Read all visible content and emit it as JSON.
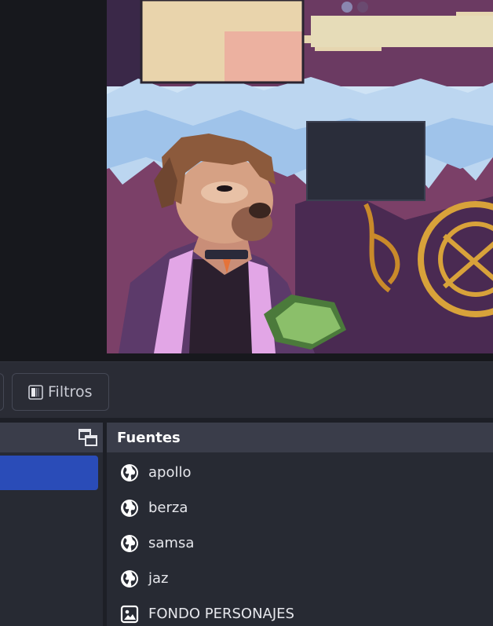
{
  "toolbar": {
    "filters_label": "Filtros"
  },
  "sources": {
    "title": "Fuentes",
    "items": [
      {
        "label": "apollo",
        "icon": "globe-icon"
      },
      {
        "label": "berza",
        "icon": "globe-icon"
      },
      {
        "label": "samsa",
        "icon": "globe-icon"
      },
      {
        "label": "jaz",
        "icon": "globe-icon"
      },
      {
        "label": "FONDO PERSONAJES",
        "icon": "image-icon"
      }
    ]
  },
  "colors": {
    "selected_scene": "#2a4cb8",
    "dock_header": "#3a3d4a",
    "dock_bg": "#272a33"
  }
}
